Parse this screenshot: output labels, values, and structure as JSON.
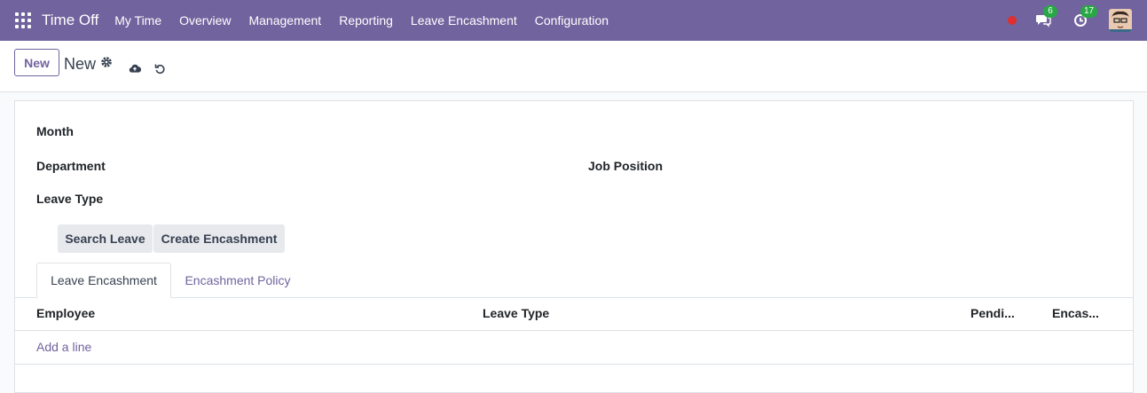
{
  "navbar": {
    "app_title": "Time Off",
    "menu": [
      "My Time",
      "Overview",
      "Management",
      "Reporting",
      "Leave Encashment",
      "Configuration"
    ],
    "messages_count": "6",
    "activities_count": "17",
    "accent_color": "#71639e"
  },
  "control_panel": {
    "new_button": "New",
    "record_name": "New"
  },
  "form": {
    "month_label": "Month",
    "department_label": "Department",
    "job_position_label": "Job Position",
    "leave_type_label": "Leave Type",
    "search_leave_button": "Search Leave",
    "create_encashment_button": "Create Encashment"
  },
  "tabs": [
    "Leave Encashment",
    "Encashment Policy"
  ],
  "table": {
    "columns": [
      "Employee",
      "Leave Type",
      "Pendi...",
      "Encas..."
    ],
    "add_line": "Add a line"
  }
}
